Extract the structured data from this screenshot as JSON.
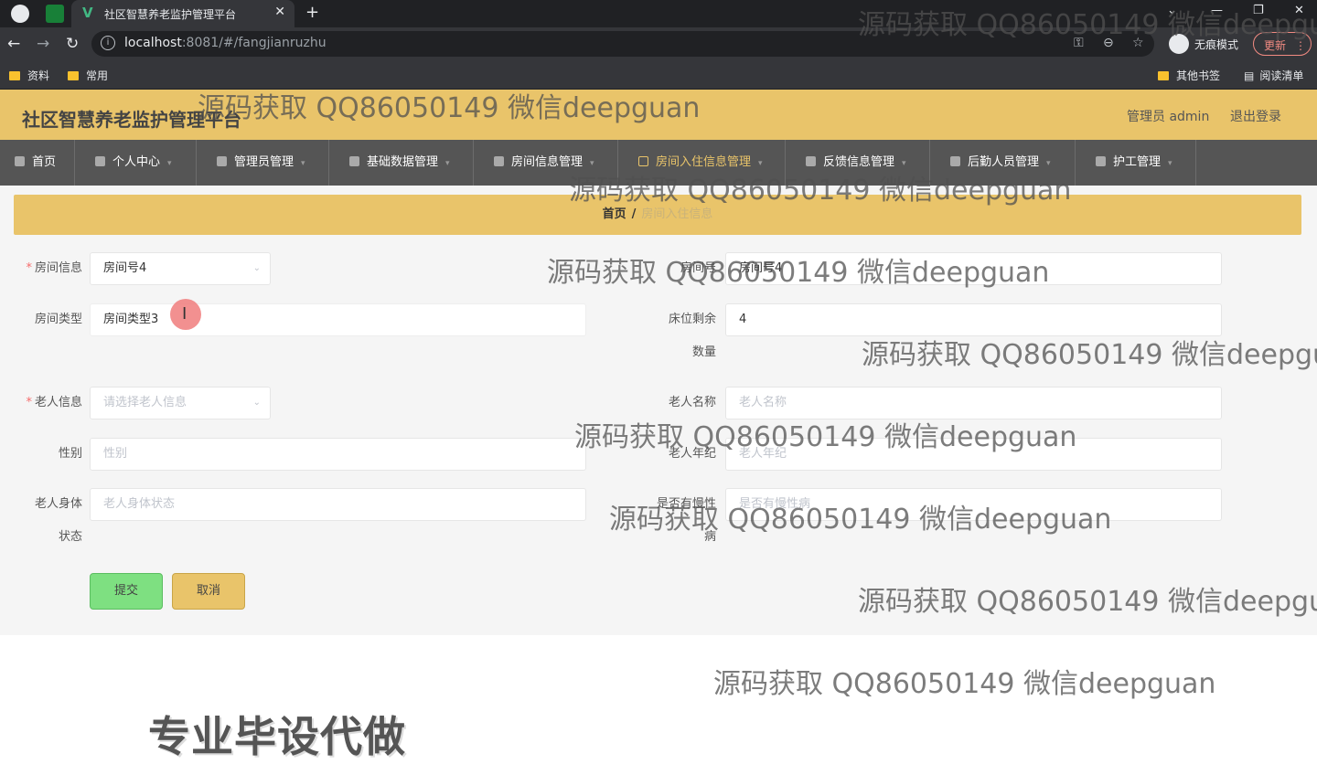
{
  "browser": {
    "tab_title": "社区智慧养老监护管理平台",
    "tab_logo": "V",
    "tab_close": "✕",
    "new_tab": "+",
    "url_host": "localhost",
    "url_path": ":8081/#/fangjianruzhu",
    "incognito_label": "无痕模式",
    "update_label": "更新",
    "bookmarks": [
      "资料",
      "常用"
    ],
    "bookmarks_right": [
      "其他书签",
      "阅读清单"
    ]
  },
  "header": {
    "title": "社区智慧养老监护管理平台",
    "admin": "管理员 admin",
    "logout": "退出登录"
  },
  "nav": {
    "items": [
      "首页",
      "个人中心",
      "管理员管理",
      "基础数据管理",
      "房间信息管理",
      "房间入住信息管理",
      "反馈信息管理",
      "后勤人员管理",
      "护工管理"
    ]
  },
  "breadcrumb": {
    "home": "首页",
    "separator": "/",
    "current": "房间入住信息"
  },
  "form": {
    "room_info_label": "房间信息",
    "room_info_value": "房间号4",
    "room_no_label": "房间号",
    "room_no_value": "房间号4",
    "room_type_label": "房间类型",
    "room_type_value": "房间类型3",
    "beds_left_label_1": "床位剩余",
    "beds_left_label_2": "数量",
    "beds_left_value": "4",
    "elder_info_label": "老人信息",
    "elder_info_placeholder": "请选择老人信息",
    "elder_name_label": "老人名称",
    "elder_name_placeholder": "老人名称",
    "gender_label": "性别",
    "gender_placeholder": "性别",
    "elder_age_label": "老人年纪",
    "elder_age_placeholder": "老人年纪",
    "elder_health_label_1": "老人身体",
    "elder_health_label_2": "状态",
    "elder_health_placeholder": "老人身体状态",
    "chronic_label_1": "是否有慢性",
    "chronic_label_2": "病",
    "chronic_placeholder": "是否有慢性病",
    "submit": "提交",
    "cancel": "取消"
  },
  "watermark": "源码获取 QQ86050149 微信deepguan",
  "promo": "专业毕设代做",
  "colors": {
    "header_bg": "#e9c46a",
    "nav_bg": "#555555",
    "submit_bg": "#7ee081",
    "cancel_bg": "#e9c46a"
  }
}
